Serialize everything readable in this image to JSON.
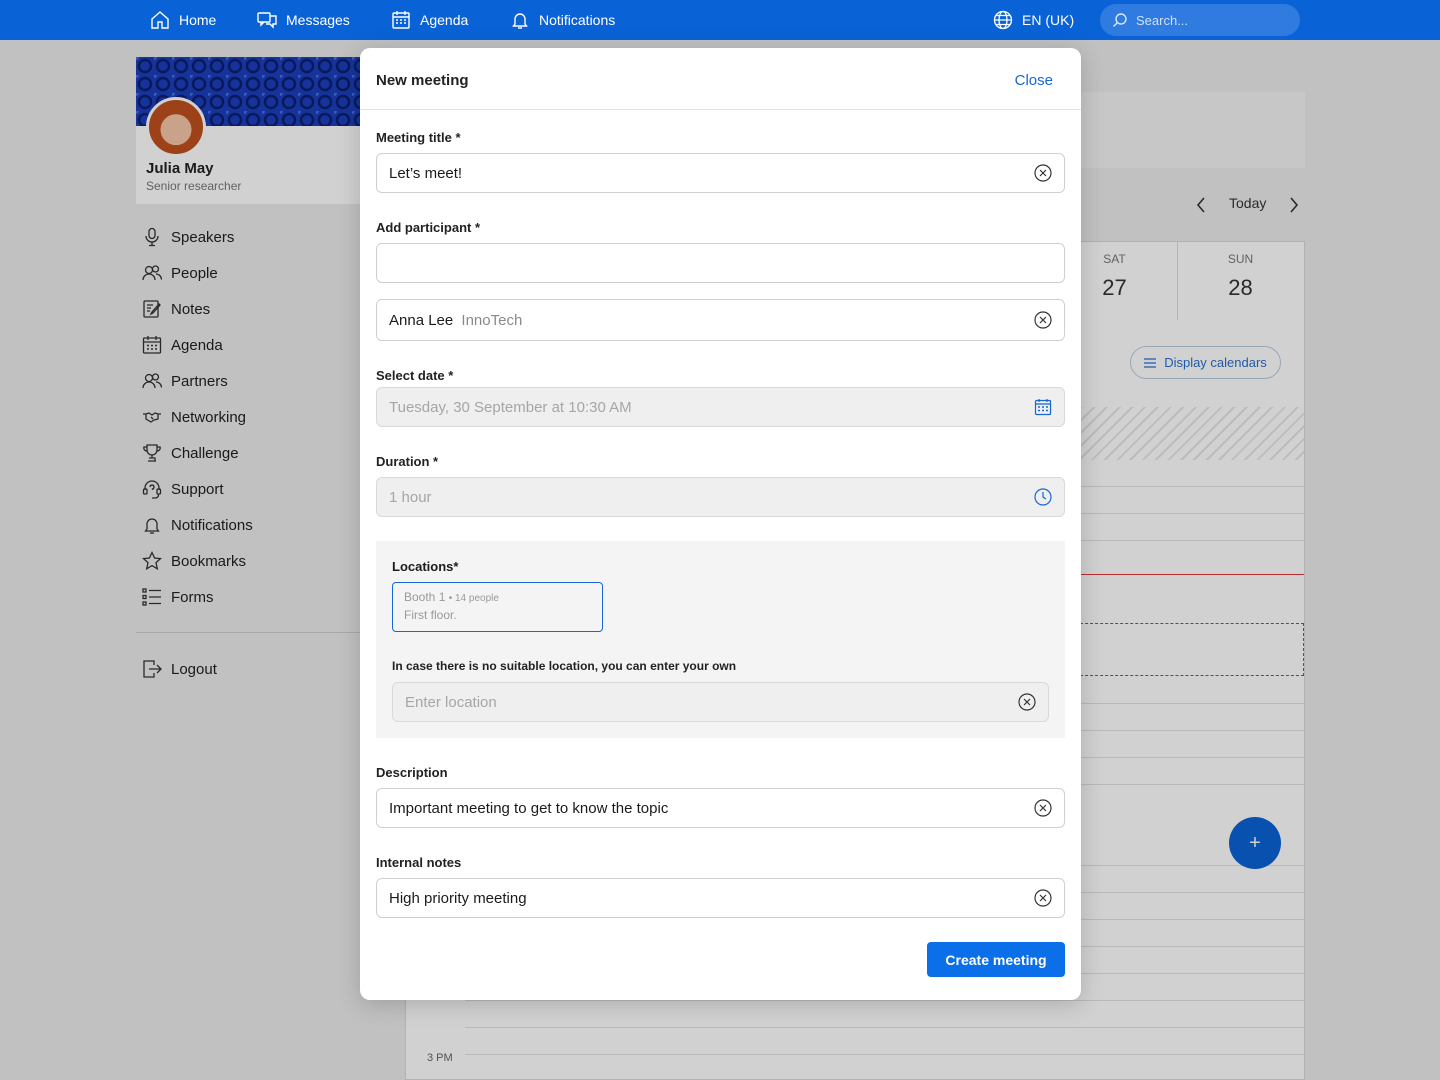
{
  "topbar": {
    "nav": [
      {
        "label": "Home",
        "icon": "home-icon"
      },
      {
        "label": "Messages",
        "icon": "messages-icon"
      },
      {
        "label": "Agenda",
        "icon": "calendar-icon"
      },
      {
        "label": "Notifications",
        "icon": "bell-icon"
      }
    ],
    "language": "EN (UK)",
    "search_placeholder": "Search..."
  },
  "profile": {
    "name": "Julia May",
    "role": "Senior researcher"
  },
  "sidebar": {
    "items": [
      {
        "label": "Speakers",
        "icon": "microphone-icon"
      },
      {
        "label": "People",
        "icon": "people-icon"
      },
      {
        "label": "Notes",
        "icon": "notes-icon"
      },
      {
        "label": "Agenda",
        "icon": "calendar-icon"
      },
      {
        "label": "Partners",
        "icon": "partners-icon"
      },
      {
        "label": "Networking",
        "icon": "handshake-icon"
      },
      {
        "label": "Challenge",
        "icon": "trophy-icon"
      },
      {
        "label": "Support",
        "icon": "headset-icon"
      },
      {
        "label": "Notifications",
        "icon": "bell-icon"
      },
      {
        "label": "Bookmarks",
        "icon": "star-icon"
      },
      {
        "label": "Forms",
        "icon": "list-icon"
      }
    ],
    "logout": "Logout"
  },
  "calendar": {
    "today": "Today",
    "days": [
      {
        "name": "SAT",
        "date": "27"
      },
      {
        "name": "SUN",
        "date": "28"
      }
    ],
    "display_calendars": "Display calendars",
    "time_label": "3 PM",
    "fab": "+"
  },
  "modal": {
    "title": "New meeting",
    "close": "Close",
    "meeting_title_label": "Meeting title *",
    "meeting_title_value": "Let’s meet!",
    "participant_label": "Add participant *",
    "participant_value": "",
    "participant": {
      "name": "Anna Lee",
      "company": "InnoTech"
    },
    "date_label": "Select date *",
    "date_value": "Tuesday, 30 September at 10:30 AM",
    "duration_label": "Duration *",
    "duration_value": "1 hour",
    "locations_label": "Locations*",
    "location_option": {
      "name": "Booth 1",
      "capacity": "14 people",
      "detail": "First floor."
    },
    "custom_location_label": "In case there is no suitable location, you can enter your own",
    "custom_location_placeholder": "Enter location",
    "description_label": "Description",
    "description_value": "Important meeting to get to know the topic",
    "notes_label": "Internal notes",
    "notes_value": "High priority meeting",
    "submit": "Create meeting"
  },
  "colors": {
    "brand": "#0a63d6",
    "link": "#1666d6",
    "button": "#0a6fe8"
  }
}
